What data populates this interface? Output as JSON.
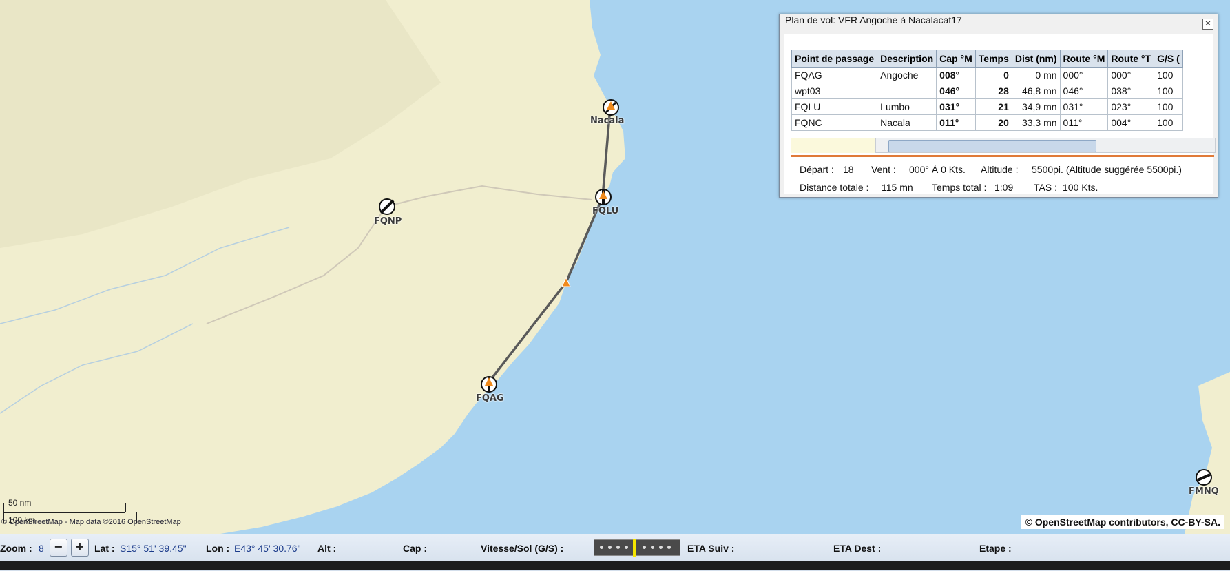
{
  "map": {
    "waypoints": [
      {
        "id": "FQNP"
      },
      {
        "id": "FQAG"
      },
      {
        "id": "FQLU"
      },
      {
        "id": "Nacala"
      },
      {
        "id": "FMNQ"
      }
    ],
    "scale": {
      "nm": "50 nm",
      "km": "100 km"
    },
    "attribution_small": "© OpenStreetMap - Map data ©2016 OpenStreetMap",
    "attribution": "© OpenStreetMap contributors, CC-BY-SA.",
    "colors": {
      "land": "#f3efd0",
      "sea": "#a9d3f0",
      "route": "#5a5a5a",
      "marker": "#f08a1c"
    }
  },
  "flight_plan": {
    "title": "Plan de vol: VFR Angoche à Nacalacat17",
    "close_icon": "close-icon",
    "columns": [
      "Point de passage",
      "Description",
      "Cap °M",
      "Temps",
      "Dist (nm)",
      "Route °M",
      "Route °T",
      "G/S ("
    ],
    "rows": [
      {
        "point": "FQAG",
        "description": "Angoche",
        "cap": "008°",
        "temps": "0",
        "dist": "0 mn",
        "route_m": "000°",
        "route_t": "000°",
        "gs": "100"
      },
      {
        "point": "wpt03",
        "description": "",
        "cap": "046°",
        "temps": "28",
        "dist": "46,8 mn",
        "route_m": "046°",
        "route_t": "038°",
        "gs": "100"
      },
      {
        "point": "FQLU",
        "description": "Lumbo",
        "cap": "031°",
        "temps": "21",
        "dist": "34,9 mn",
        "route_m": "031°",
        "route_t": "023°",
        "gs": "100"
      },
      {
        "point": "FQNC",
        "description": "Nacala",
        "cap": "011°",
        "temps": "20",
        "dist": "33,3 mn",
        "route_m": "011°",
        "route_t": "004°",
        "gs": "100"
      }
    ],
    "info": {
      "depart_label": "Départ :",
      "depart_value": "18",
      "vent_label": "Vent :",
      "vent_value": "000° À 0 Kts.",
      "altitude_label": "Altitude :",
      "altitude_value": "5500pi. (Altitude suggérée 5500pi.)",
      "distance_label": "Distance totale :",
      "distance_value": "115 mn",
      "temps_label": "Temps total :",
      "temps_value": "1:09",
      "tas_label": "TAS :",
      "tas_value": "100 Kts."
    }
  },
  "statusbar": {
    "zoom_label": "Zoom :",
    "zoom_value": "8",
    "zoom_out": "−",
    "zoom_in": "+",
    "lat_label": "Lat :",
    "lat_value": "S15° 51' 39.45\"",
    "lon_label": "Lon :",
    "lon_value": "E43° 45' 30.76\"",
    "alt_label": "Alt :",
    "cap_label": "Cap :",
    "vitesse_label": "Vitesse/Sol (G/S) :",
    "eta_suiv_label": "ETA Suiv :",
    "eta_dest_label": "ETA Dest :",
    "etape_label": "Etape :"
  }
}
